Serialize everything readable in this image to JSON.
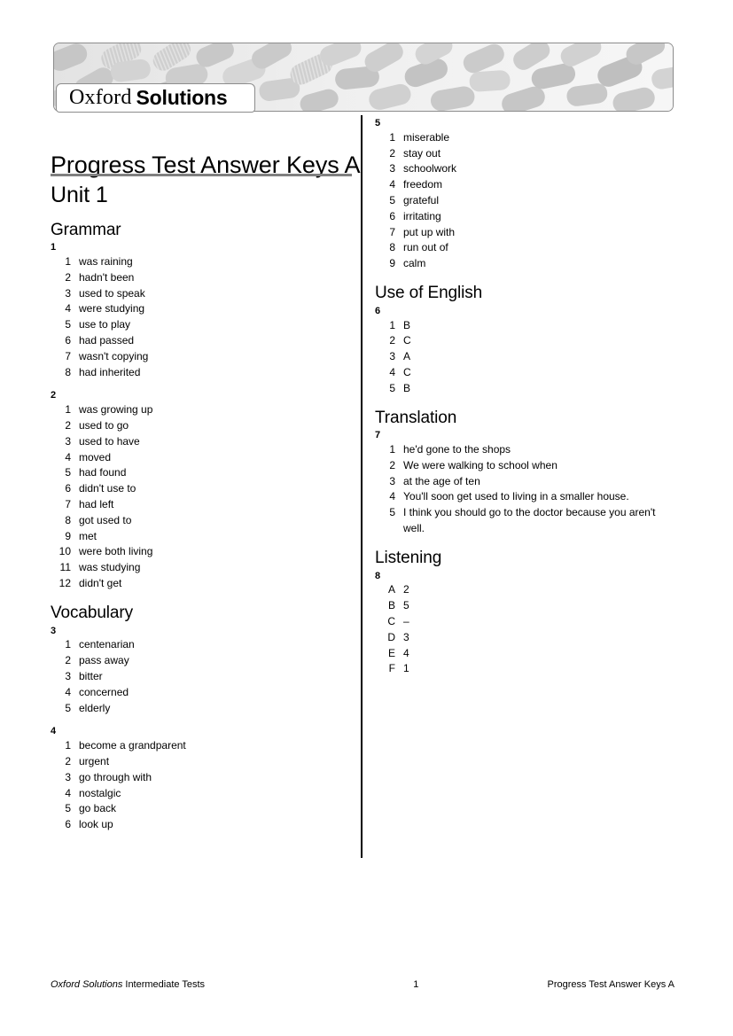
{
  "document": {
    "title": "Progress Test Answer Keys A",
    "logo": {
      "word1": "Oxford",
      "word2": "Solutions"
    },
    "unit_heading": "Unit 1"
  },
  "footer": {
    "brand": "Oxford Solutions",
    "left_rest": " Intermediate Tests",
    "page_number": "1",
    "right": "Progress Test Answer Keys A"
  },
  "sections": {
    "grammar": {
      "heading": "Grammar"
    },
    "vocabulary": {
      "heading": "Vocabulary"
    },
    "use_of_english": {
      "heading": "Use of English"
    },
    "translation": {
      "heading": "Translation"
    },
    "listening": {
      "heading": "Listening"
    }
  },
  "exercises": {
    "ex1": {
      "number": "1",
      "items": [
        {
          "key": "1",
          "value": "was raining"
        },
        {
          "key": "2",
          "value": "hadn't been"
        },
        {
          "key": "3",
          "value": "used to speak"
        },
        {
          "key": "4",
          "value": "were studying"
        },
        {
          "key": "5",
          "value": "use to play"
        },
        {
          "key": "6",
          "value": "had passed"
        },
        {
          "key": "7",
          "value": "wasn't copying"
        },
        {
          "key": "8",
          "value": "had inherited"
        }
      ]
    },
    "ex2": {
      "number": "2",
      "items": [
        {
          "key": "1",
          "value": "was growing up"
        },
        {
          "key": "2",
          "value": "used to go"
        },
        {
          "key": "3",
          "value": "used to have"
        },
        {
          "key": "4",
          "value": "moved"
        },
        {
          "key": "5",
          "value": "had found"
        },
        {
          "key": "6",
          "value": "didn't use to"
        },
        {
          "key": "7",
          "value": "had left"
        },
        {
          "key": "8",
          "value": "got used to"
        },
        {
          "key": "9",
          "value": "met"
        },
        {
          "key": "10",
          "value": "were both living"
        },
        {
          "key": "11",
          "value": "was studying"
        },
        {
          "key": "12",
          "value": "didn't get"
        }
      ]
    },
    "ex3": {
      "number": "3",
      "items": [
        {
          "key": "1",
          "value": "centenarian"
        },
        {
          "key": "2",
          "value": "pass away"
        },
        {
          "key": "3",
          "value": "bitter"
        },
        {
          "key": "4",
          "value": "concerned"
        },
        {
          "key": "5",
          "value": "elderly"
        }
      ]
    },
    "ex4": {
      "number": "4",
      "items": [
        {
          "key": "1",
          "value": "become a grandparent"
        },
        {
          "key": "2",
          "value": "urgent"
        },
        {
          "key": "3",
          "value": "go through with"
        },
        {
          "key": "4",
          "value": "nostalgic"
        },
        {
          "key": "5",
          "value": "go back"
        },
        {
          "key": "6",
          "value": "look up"
        }
      ]
    },
    "ex5": {
      "number": "5",
      "items": [
        {
          "key": "1",
          "value": "miserable"
        },
        {
          "key": "2",
          "value": "stay out"
        },
        {
          "key": "3",
          "value": "schoolwork"
        },
        {
          "key": "4",
          "value": "freedom"
        },
        {
          "key": "5",
          "value": "grateful"
        },
        {
          "key": "6",
          "value": "irritating"
        },
        {
          "key": "7",
          "value": "put up with"
        },
        {
          "key": "8",
          "value": "run out of"
        },
        {
          "key": "9",
          "value": "calm"
        }
      ]
    },
    "ex6": {
      "number": "6",
      "items": [
        {
          "key": "1",
          "value": "B"
        },
        {
          "key": "2",
          "value": "C"
        },
        {
          "key": "3",
          "value": "A"
        },
        {
          "key": "4",
          "value": "C"
        },
        {
          "key": "5",
          "value": "B"
        }
      ]
    },
    "ex7": {
      "number": "7",
      "items": [
        {
          "key": "1",
          "value": "he'd gone to the shops"
        },
        {
          "key": "2",
          "value": "We were walking to school when"
        },
        {
          "key": "3",
          "value": "at the age of ten"
        },
        {
          "key": "4",
          "value": "You'll soon get used to living in a smaller house."
        },
        {
          "key": "5",
          "value": "I think you should go to the doctor because you aren't well."
        }
      ]
    },
    "ex8": {
      "number": "8",
      "items": [
        {
          "key": "A",
          "value": "2"
        },
        {
          "key": "B",
          "value": "5"
        },
        {
          "key": "C",
          "value": "–"
        },
        {
          "key": "D",
          "value": "3"
        },
        {
          "key": "E",
          "value": "4"
        },
        {
          "key": "F",
          "value": "1"
        }
      ]
    }
  }
}
